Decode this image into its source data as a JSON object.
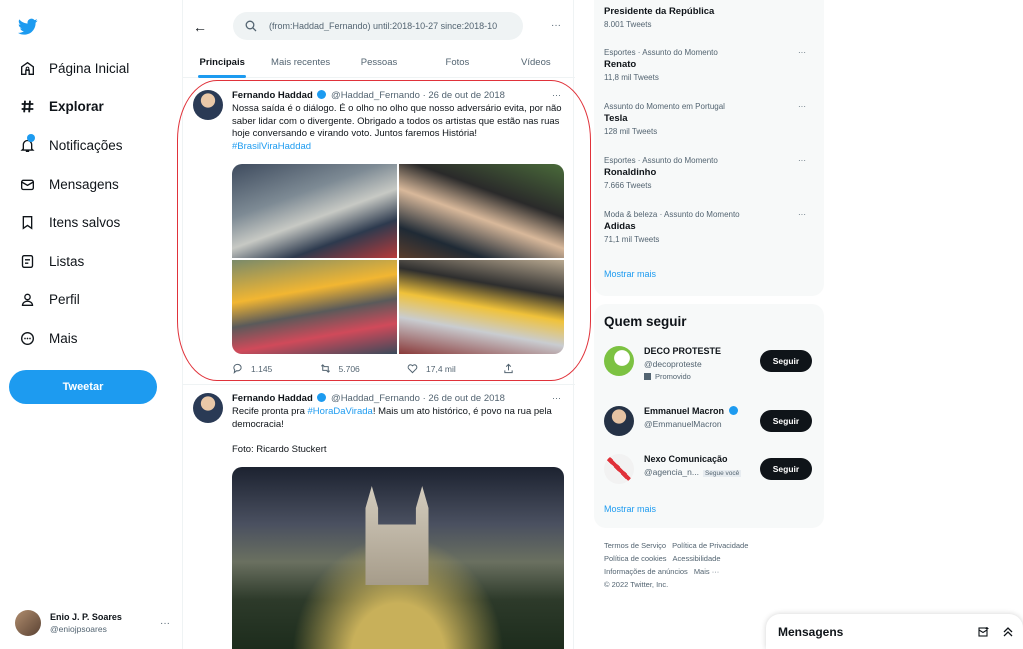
{
  "sidebar": {
    "items": [
      {
        "label": "Página Inicial",
        "icon": "home-icon"
      },
      {
        "label": "Explorar",
        "icon": "hashtag-icon"
      },
      {
        "label": "Notificações",
        "icon": "bell-icon"
      },
      {
        "label": "Mensagens",
        "icon": "envelope-icon"
      },
      {
        "label": "Itens salvos",
        "icon": "bookmark-icon"
      },
      {
        "label": "Listas",
        "icon": "list-icon"
      },
      {
        "label": "Perfil",
        "icon": "person-icon"
      },
      {
        "label": "Mais",
        "icon": "more-circle-icon"
      }
    ],
    "tweet_label": "Tweetar",
    "account": {
      "name": "Enio J. P. Soares",
      "handle": "@eniojpsoares"
    }
  },
  "search": {
    "value": "(from:Haddad_Fernando) until:2018-10-27 since:2018-10"
  },
  "tabs": [
    "Principais",
    "Mais recentes",
    "Pessoas",
    "Fotos",
    "Vídeos"
  ],
  "tweets": [
    {
      "name": "Fernando Haddad",
      "handle": "@Haddad_Fernando",
      "date": "· 26 de out de 2018",
      "text": "Nossa saída é o diálogo. É o olho no olho que nosso adversário evita, por não saber lidar com o divergente. Obrigado a todos os artistas que estão nas ruas hoje conversando e virando voto. Juntos faremos História!",
      "hashtag": "#BrasilViraHaddad",
      "replies": "1.145",
      "retweets": "5.706",
      "likes": "17,4 mil"
    },
    {
      "name": "Fernando Haddad",
      "handle": "@Haddad_Fernando",
      "date": "· 26 de out de 2018",
      "text_pre": "Recife pronta pra ",
      "hashtag": "#HoraDaVirada",
      "text_post": "! Mais um ato histórico, é povo na rua pela democracia!",
      "photo_credit": "Foto: Ricardo Stuckert"
    }
  ],
  "trends": [
    {
      "category": "",
      "name": "Presidente da República",
      "count": "8.001 Tweets"
    },
    {
      "category": "Esportes · Assunto do Momento",
      "name": "Renato",
      "count": "11,8 mil Tweets"
    },
    {
      "category": "Assunto do Momento em Portugal",
      "name": "Tesla",
      "count": "128 mil Tweets"
    },
    {
      "category": "Esportes · Assunto do Momento",
      "name": "Ronaldinho",
      "count": "7.666 Tweets"
    },
    {
      "category": "Moda & beleza · Assunto do Momento",
      "name": "Adidas",
      "count": "71,1 mil Tweets"
    }
  ],
  "trends_show_more": "Mostrar mais",
  "follow": {
    "title": "Quem seguir",
    "button_label": "Seguir",
    "show_more": "Mostrar mais",
    "accounts": [
      {
        "name": "DECO PROTESTE",
        "handle": "@decoproteste",
        "promo": "Promovido"
      },
      {
        "name": "Emmanuel Macron",
        "handle": "@EmmanuelMacron"
      },
      {
        "name": "Nexo Comunicação",
        "handle": "@agencia_n...",
        "follows_you": "Segue você"
      }
    ]
  },
  "footer": {
    "terms": "Termos de Serviço",
    "privacy": "Política de Privacidade",
    "cookies": "Política de cookies",
    "accessibility": "Acessibilidade",
    "ads": "Informações de anúncios",
    "more": "Mais ···",
    "copyright": "© 2022 Twitter, Inc."
  },
  "messages_drawer": {
    "title": "Mensagens"
  },
  "colors": {
    "accent": "#1d9bf0",
    "highlight": "#e0323a",
    "text": "#0f1419",
    "muted": "#536471"
  }
}
